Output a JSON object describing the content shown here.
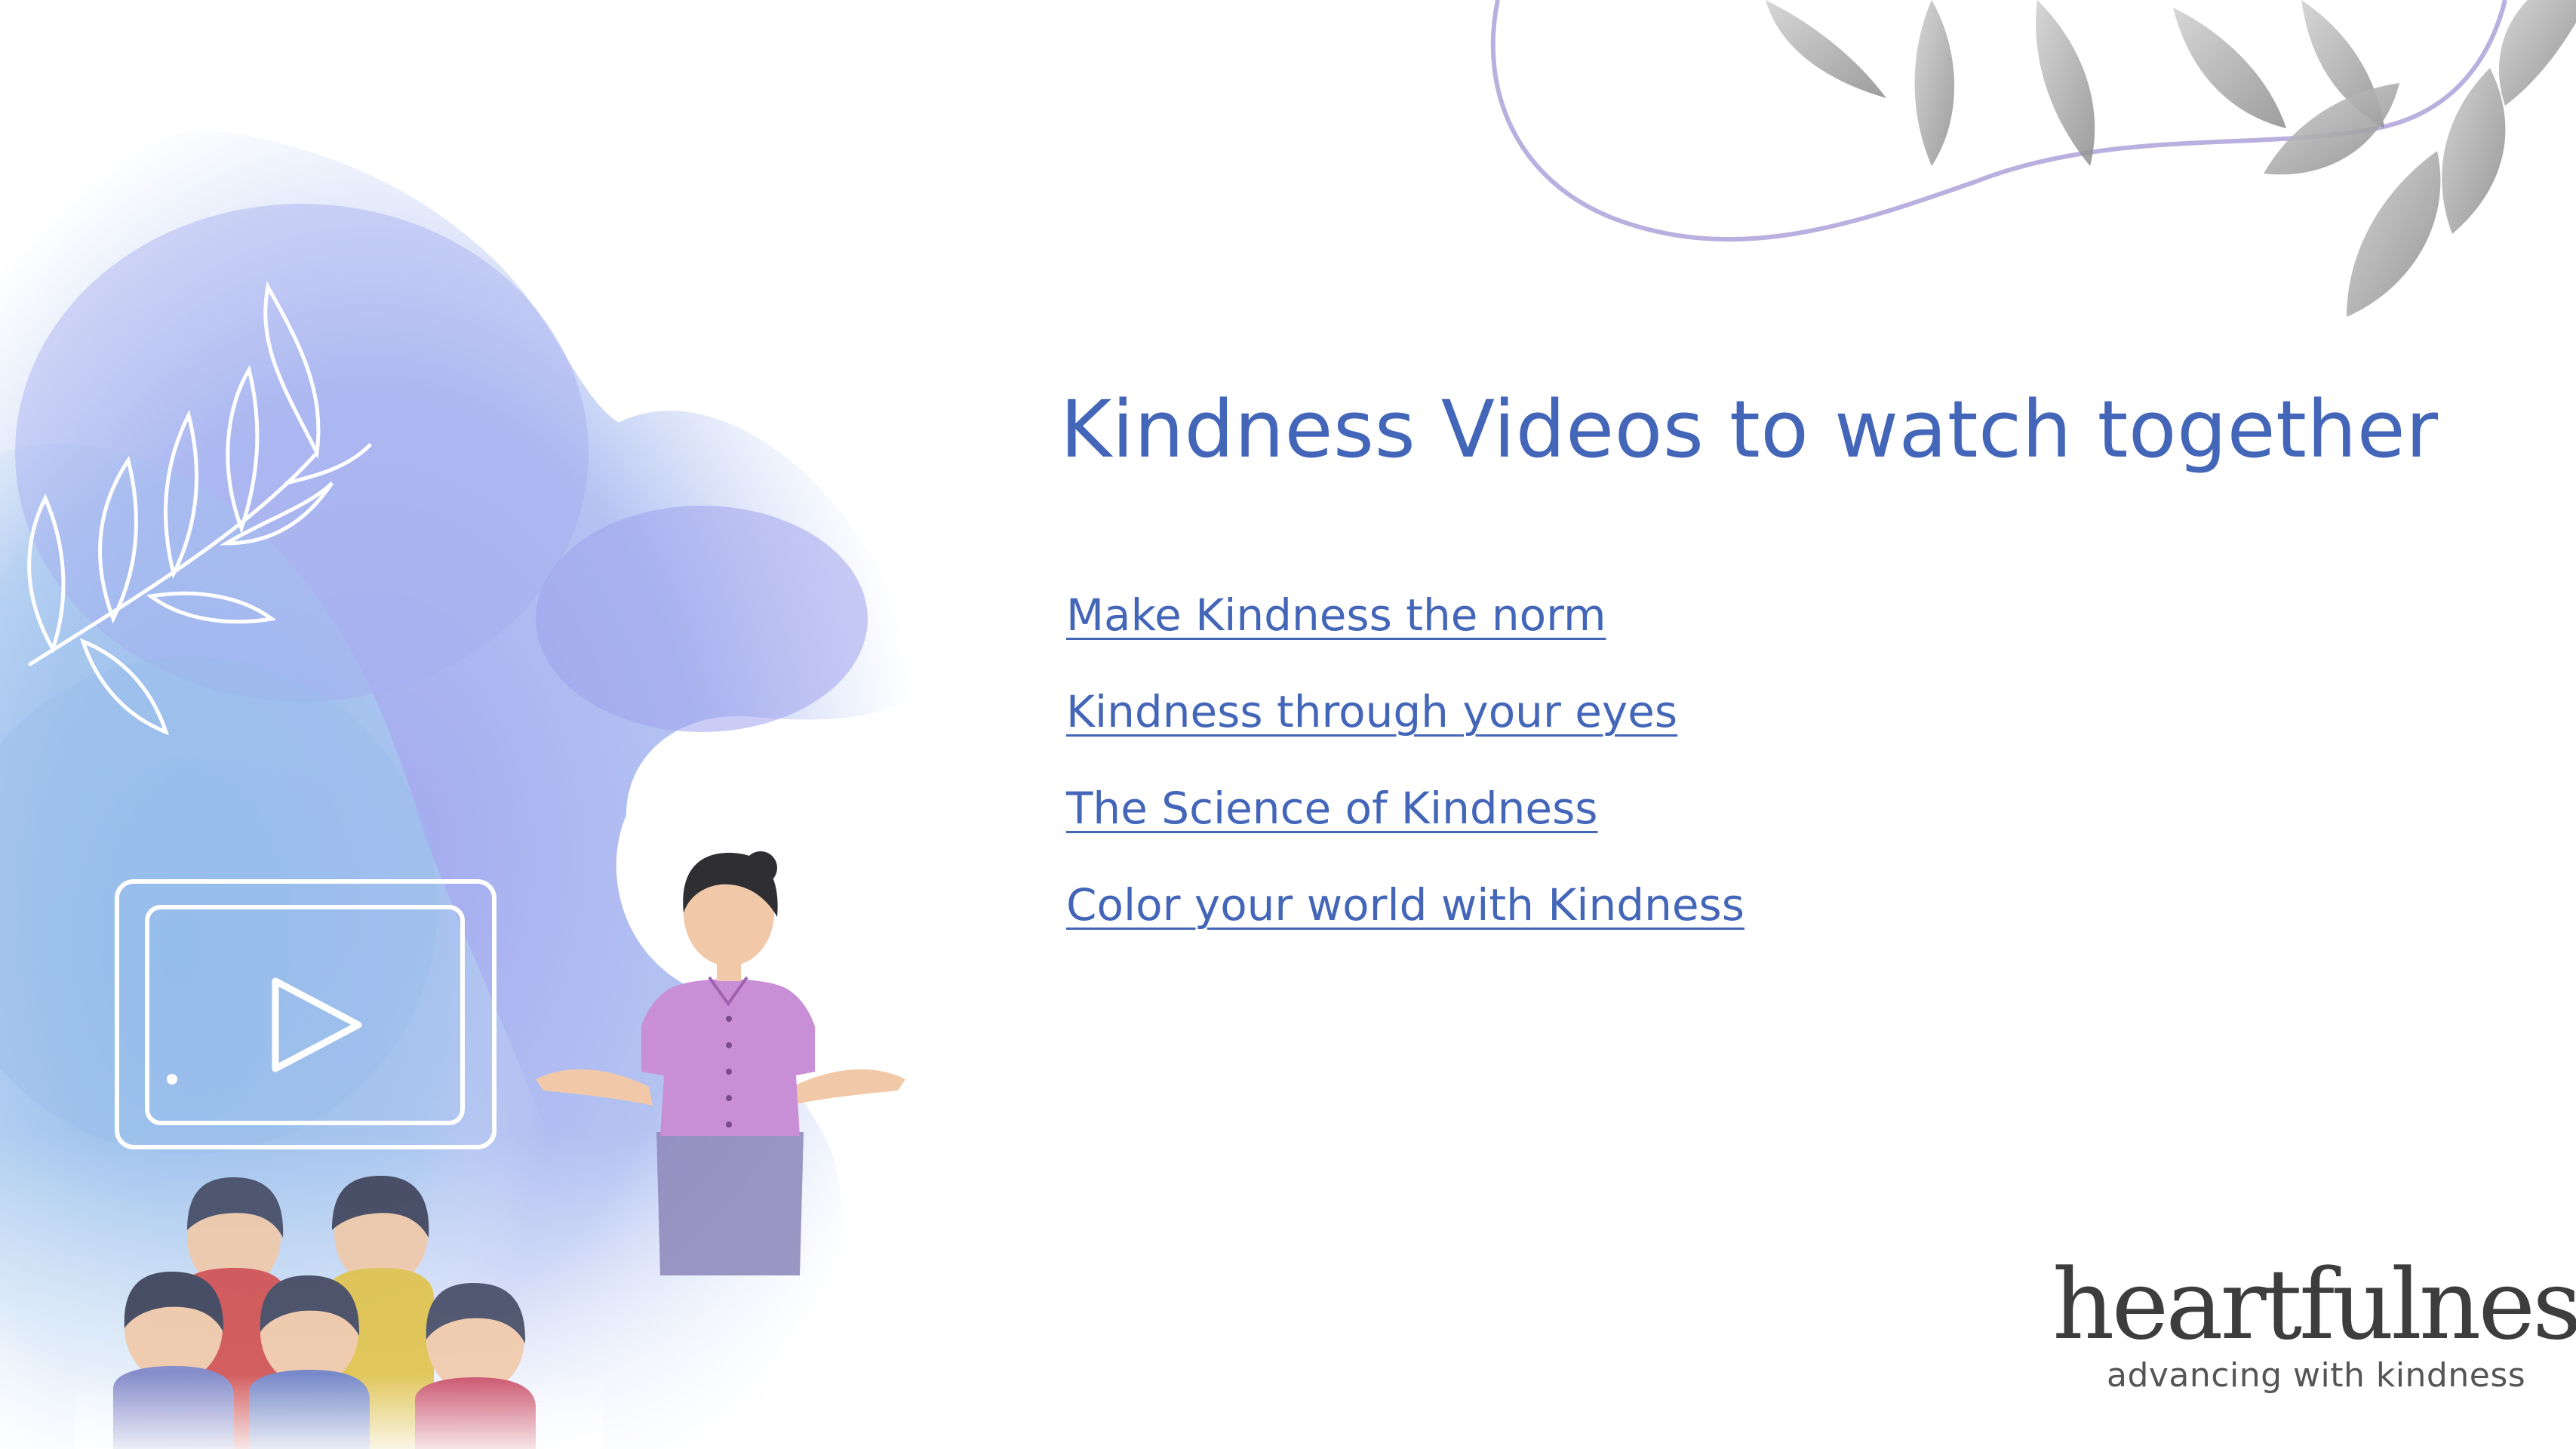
{
  "slide": {
    "title": "Kindness Videos to watch together",
    "links": [
      {
        "label": "Make Kindness the norm"
      },
      {
        "label": "Kindness through your eyes"
      },
      {
        "label": "The Science of Kindness"
      },
      {
        "label": "Color your world with Kindness"
      }
    ]
  },
  "logo": {
    "wordmark": "heartfulness",
    "tagline": "advancing with kindness"
  },
  "colors": {
    "accent": "#4466b8",
    "watercolor": "#8f93e8",
    "shirt": "#c98fd6",
    "line": "#b9b0df"
  },
  "icons": [
    "leaf-branch-icon",
    "video-play-icon",
    "leaves-decoration-icon"
  ]
}
